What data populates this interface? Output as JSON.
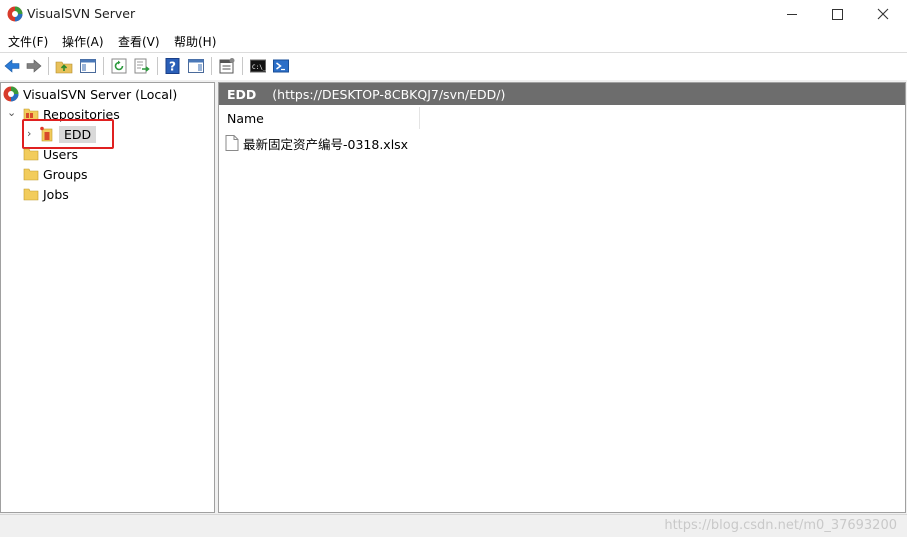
{
  "window": {
    "title": "VisualSVN Server",
    "controls": {
      "minimize": "—",
      "maximize": "☐",
      "close": "✕"
    }
  },
  "menu": [
    {
      "label": "文件(F)"
    },
    {
      "label": "操作(A)"
    },
    {
      "label": "查看(V)"
    },
    {
      "label": "帮助(H)"
    }
  ],
  "toolbar": {
    "icons": [
      "back-icon",
      "forward-icon",
      "up-folder-icon",
      "show-hide-console-tree-icon",
      "refresh-icon",
      "export-list-icon",
      "help-icon",
      "action-pane-icon",
      "properties-icon",
      "command-prompt-icon",
      "powershell-icon"
    ]
  },
  "tree": {
    "root": {
      "label": "VisualSVN Server (Local)"
    },
    "repositories": {
      "label": "Repositories",
      "expand": "⌄"
    },
    "repository": {
      "label": "EDD",
      "expand": "›"
    },
    "users": {
      "label": "Users"
    },
    "groups": {
      "label": "Groups"
    },
    "jobs": {
      "label": "Jobs"
    }
  },
  "details": {
    "title": "EDD",
    "url": "(https://DESKTOP-8CBKQJ7/svn/EDD/)",
    "column_name": "Name",
    "files": [
      "最新固定资产编号-0318.xlsx"
    ]
  },
  "status": {
    "watermark": "https://blog.csdn.net/m0_37693200"
  },
  "colors": {
    "header_band": "#6d6d6d",
    "highlight": "#e02020",
    "selection": "#d9d9d9"
  }
}
